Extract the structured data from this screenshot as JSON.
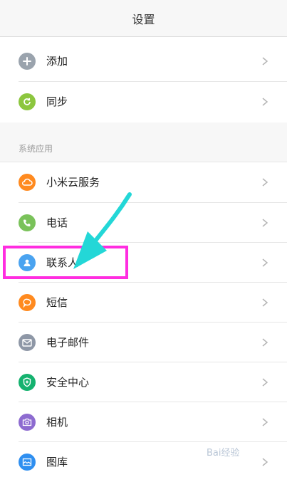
{
  "header": {
    "title": "设置"
  },
  "top_items": [
    {
      "label": "添加"
    },
    {
      "label": "同步"
    }
  ],
  "section": {
    "title": "系统应用"
  },
  "system_items": [
    {
      "label": "小米云服务",
      "color": "#ff8a1f",
      "icon": "cloud-icon"
    },
    {
      "label": "电话",
      "color": "#7ac25a",
      "icon": "phone-icon"
    },
    {
      "label": "联系人",
      "color": "#4aa3f0",
      "icon": "person-icon"
    },
    {
      "label": "短信",
      "color": "#ff8a1f",
      "icon": "message-icon"
    },
    {
      "label": "电子邮件",
      "color": "#8e97a6",
      "icon": "mail-icon"
    },
    {
      "label": "安全中心",
      "color": "#15b26f",
      "icon": "shield-icon"
    },
    {
      "label": "相机",
      "color": "#8d6bd0",
      "icon": "camera-icon"
    },
    {
      "label": "图库",
      "color": "#2f8ff0",
      "icon": "gallery-icon"
    }
  ],
  "overlay": {
    "highlight_color": "#ff2de0",
    "arrow_color": "#23d7d7"
  },
  "watermark": {
    "text": "Bai经验"
  }
}
